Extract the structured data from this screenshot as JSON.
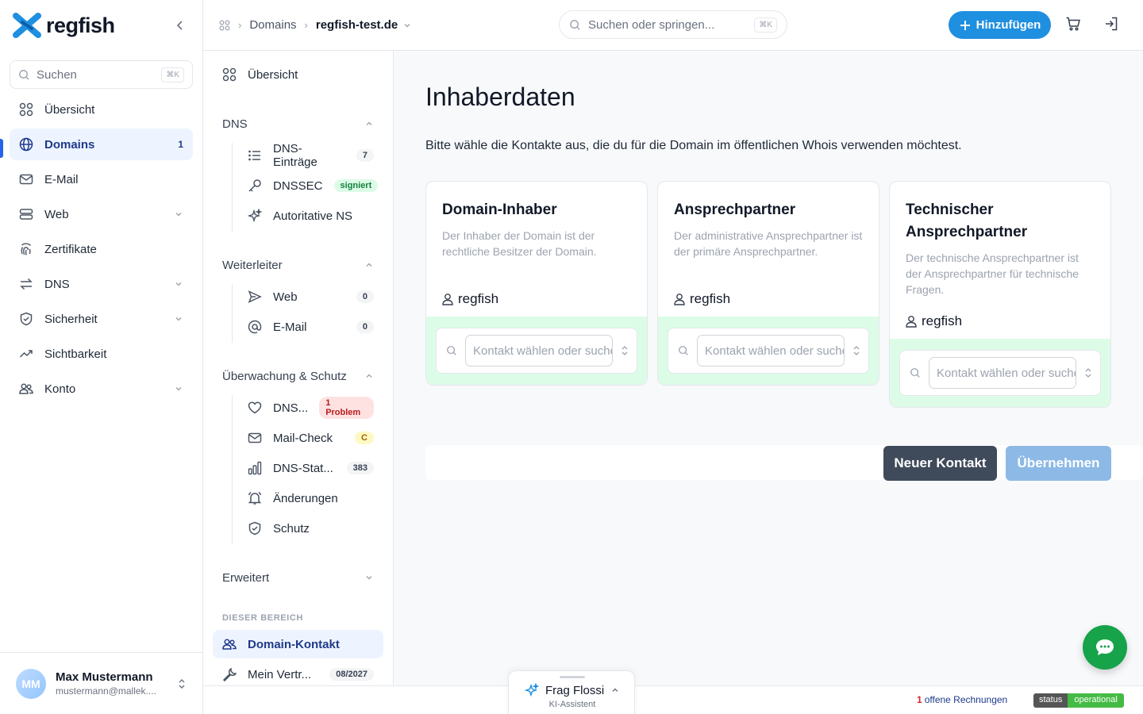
{
  "app": {
    "logo_text": "regfish"
  },
  "sidebar": {
    "search_placeholder": "Suchen",
    "search_shortcut": "⌘K",
    "items": [
      {
        "label": "Übersicht",
        "icon": "grid-icon"
      },
      {
        "label": "Domains",
        "icon": "globe-icon",
        "count": "1",
        "active": true
      },
      {
        "label": "E-Mail",
        "icon": "mail-icon"
      },
      {
        "label": "Web",
        "icon": "server-icon",
        "expandable": true
      },
      {
        "label": "Zertifikate",
        "icon": "fingerprint-icon"
      },
      {
        "label": "DNS",
        "icon": "arrows-icon",
        "expandable": true
      },
      {
        "label": "Sicherheit",
        "icon": "shield-icon",
        "expandable": true
      },
      {
        "label": "Sichtbarkeit",
        "icon": "trend-icon"
      },
      {
        "label": "Konto",
        "icon": "users-icon",
        "expandable": true
      }
    ],
    "user": {
      "initials": "MM",
      "name": "Max Mustermann",
      "email": "mustermann@mallek...."
    }
  },
  "topbar": {
    "breadcrumb": {
      "root": "Domains",
      "current": "regfish-test.de"
    },
    "search_placeholder": "Suchen oder springen...",
    "search_shortcut": "⌘K",
    "add_label": "Hinzufügen"
  },
  "subnav": {
    "overview": "Übersicht",
    "dns": {
      "label": "DNS",
      "items": [
        {
          "label": "DNS-Einträge",
          "badge": "7"
        },
        {
          "label": "DNSSEC",
          "badge": "signiert"
        },
        {
          "label": "Autoritative NS"
        }
      ]
    },
    "forwarders": {
      "label": "Weiterleiter",
      "items": [
        {
          "label": "Web",
          "badge": "0"
        },
        {
          "label": "E-Mail",
          "badge": "0"
        }
      ]
    },
    "monitoring": {
      "label": "Überwachung & Schutz",
      "items": [
        {
          "label": "DNS...",
          "badge": "1 Problem"
        },
        {
          "label": "Mail-Check",
          "badge": "C"
        },
        {
          "label": "DNS-Stat...",
          "badge": "383"
        },
        {
          "label": "Änderungen"
        },
        {
          "label": "Schutz"
        }
      ]
    },
    "advanced": "Erweitert",
    "section_label": "DIESER BEREICH",
    "domain_contact": "Domain-Kontakt",
    "contract": {
      "label": "Mein Vertr...",
      "badge": "08/2027"
    }
  },
  "main": {
    "title": "Inhaberdaten",
    "description": "Bitte wähle die Kontakte aus, die du für die Domain im öffentlichen Whois verwenden möchtest.",
    "cards": [
      {
        "title": "Domain-Inhaber",
        "text": "Der Inhaber der Domain ist der rechtliche Besitzer der Domain.",
        "owner": "regfish",
        "placeholder": "Kontakt wählen oder suchen"
      },
      {
        "title": "Ansprechpartner",
        "text": "Der administrative Ansprechpartner ist der primäre Ansprechpartner.",
        "owner": "regfish",
        "placeholder": "Kontakt wählen oder suchen"
      },
      {
        "title": "Technischer Ansprechpartner",
        "text": "Der technische Ansprechpartner ist der Ansprechpartner für technische Fragen.",
        "owner": "regfish",
        "placeholder": "Kontakt wählen oder suchen"
      }
    ],
    "new_contact_label": "Neuer Kontakt",
    "apply_label": "Übernehmen"
  },
  "footer": {
    "assistant_title": "Frag Flossi",
    "assistant_subtitle": "KI-Assistent",
    "invoices_count": "1",
    "invoices_label": "offene Rechnungen",
    "status_left": "status",
    "status_right": "operational"
  },
  "colors": {
    "brand_blue": "#1f8fe0",
    "active_nav": "#1e3a8a",
    "card_green": "#dcfce7",
    "chat_green": "#16a34a"
  }
}
